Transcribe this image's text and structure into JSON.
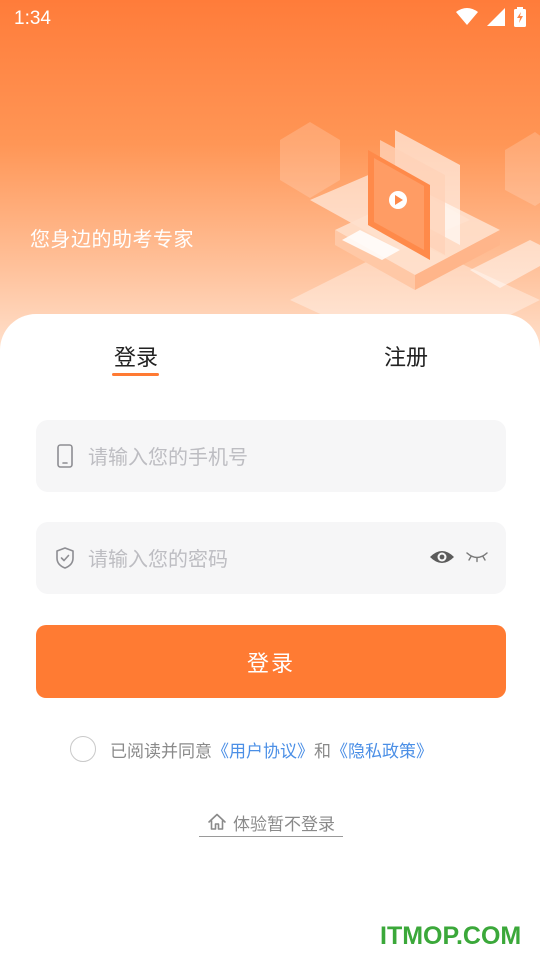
{
  "status_bar": {
    "time": "1:34"
  },
  "hero": {
    "tagline": "您身边的助考专家"
  },
  "tabs": [
    {
      "label": "登录",
      "active": true
    },
    {
      "label": "注册",
      "active": false
    }
  ],
  "phone_field": {
    "placeholder": "请输入您的手机号",
    "value": ""
  },
  "password_field": {
    "placeholder": "请输入您的密码",
    "value": ""
  },
  "login_button": {
    "label": "登录"
  },
  "agreement": {
    "prefix": "已阅读并同意",
    "user_agreement": "《用户协议》",
    "and": "和",
    "privacy_policy": "《隐私政策》",
    "checked": false
  },
  "guest_link": {
    "label": "体验暂不登录"
  },
  "watermark": {
    "text": "ITMOP.COM"
  },
  "colors": {
    "accent": "#ff7b33",
    "link": "#4b8fe6",
    "watermark": "#3ba83a"
  }
}
